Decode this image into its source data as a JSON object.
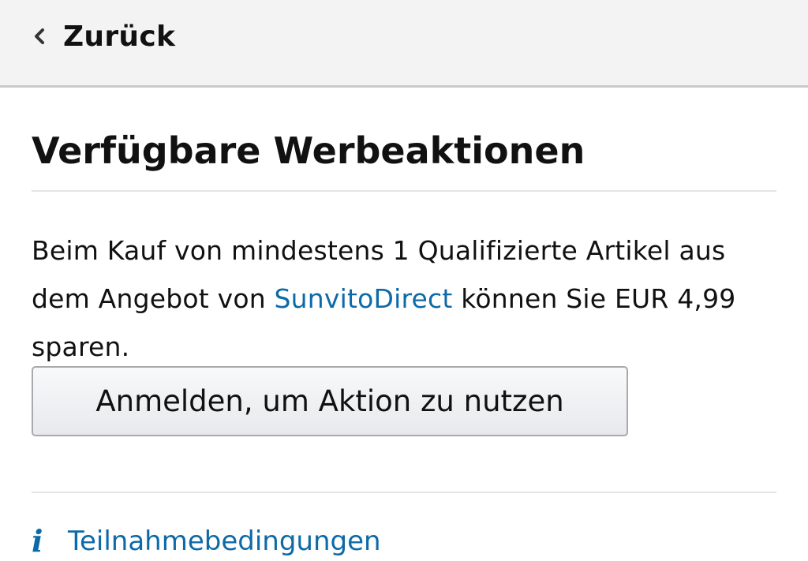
{
  "header": {
    "back_label": "Zurück",
    "back_icon": "chevron-left-icon"
  },
  "main": {
    "title": "Verfügbare Werbeaktionen",
    "promo": {
      "text_before_link": "Beim Kauf von mindestens 1 Qualifizierte Artikel aus dem Angebot von ",
      "seller_link": "SunvitoDirect",
      "text_after_link": " können Sie EUR 4,99 sparen."
    },
    "signin_button_label": "Anmelden, um Aktion zu nutzen",
    "terms": {
      "icon": "info-icon",
      "icon_glyph": "i",
      "label": "Teilnahmebedingungen"
    }
  },
  "colors": {
    "link": "#0d6aa8",
    "header_bg": "#f3f3f3",
    "text": "#111111"
  }
}
